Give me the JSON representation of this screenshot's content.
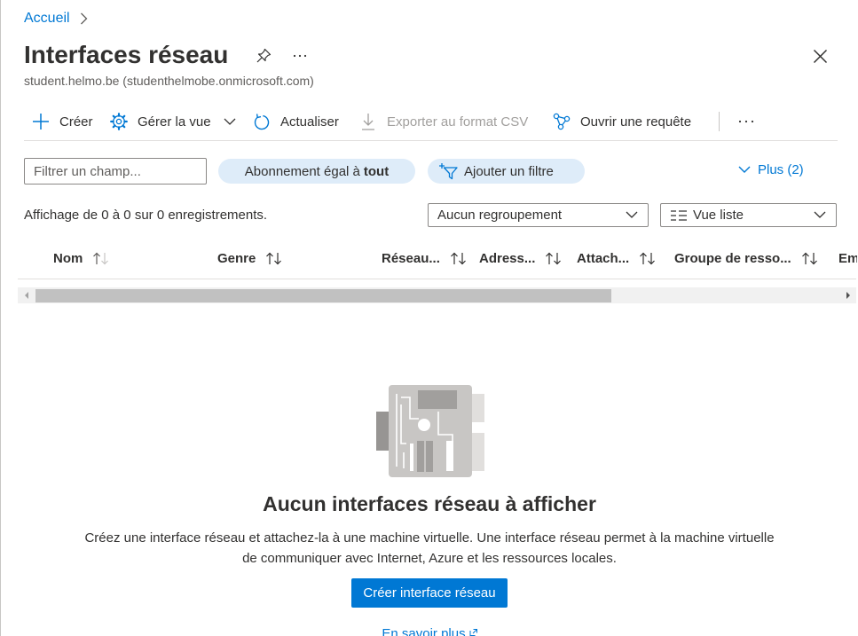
{
  "breadcrumb": {
    "home_label": "Accueil"
  },
  "header": {
    "title": "Interfaces réseau",
    "subtitle": "student.helmo.be (studenthelmobe.onmicrosoft.com)"
  },
  "toolbar": {
    "items": [
      {
        "label": "Créer",
        "icon": "plus-icon",
        "enabled": true
      },
      {
        "label": "Gérer la vue",
        "icon": "gear-icon",
        "enabled": true,
        "has_dropdown": true
      },
      {
        "label": "Actualiser",
        "icon": "refresh-icon",
        "enabled": true
      },
      {
        "label": "Exporter au format CSV",
        "icon": "download-icon",
        "enabled": false
      },
      {
        "label": "Ouvrir une requête",
        "icon": "query-icon",
        "enabled": true
      }
    ]
  },
  "filters": {
    "search_placeholder": "Filtrer un champ...",
    "subscription_filter": {
      "prefix": "Abonnement égal à",
      "value": "tout"
    },
    "add_filter_label": "Ajouter un filtre",
    "more_label": "Plus (2)"
  },
  "results": {
    "summary": "Affichage de 0 à 0 sur 0 enregistrements."
  },
  "grouping": {
    "selected": "Aucun regroupement"
  },
  "view_mode": {
    "selected": "Vue liste"
  },
  "table": {
    "columns": [
      "Nom",
      "Genre",
      "Réseau...",
      "Adress...",
      "Attach...",
      "Groupe de resso...",
      "Em"
    ],
    "rows": []
  },
  "empty_state": {
    "title": "Aucun interfaces réseau à afficher",
    "description_lines": [
      "Créez une interface réseau et attachez-la à une machine virtuelle. Une interface réseau permet à la machine virtuelle",
      "de communiquer avec Internet, Azure et les ressources locales."
    ],
    "create_button_label": "Créer interface réseau",
    "learn_more_label": "En savoir plus"
  },
  "icons": {
    "breadcrumb_separator": "chevron-right-icon",
    "pin": "pin-icon",
    "more": "more-icon",
    "close": "close-icon",
    "add_filter": "filter-add-icon",
    "more_filters": "chevron-down-icon",
    "view_mode": "list-icon",
    "sort": "sort-icon",
    "empty_state": "network-interface-icon",
    "learn_more": "external-link-icon"
  },
  "colors": {
    "accent": "#0078d4",
    "pill_background": "#deecf9",
    "text_primary": "#323130",
    "text_secondary": "#605e5c",
    "disabled": "#a19f9d",
    "border": "#8a8886"
  }
}
